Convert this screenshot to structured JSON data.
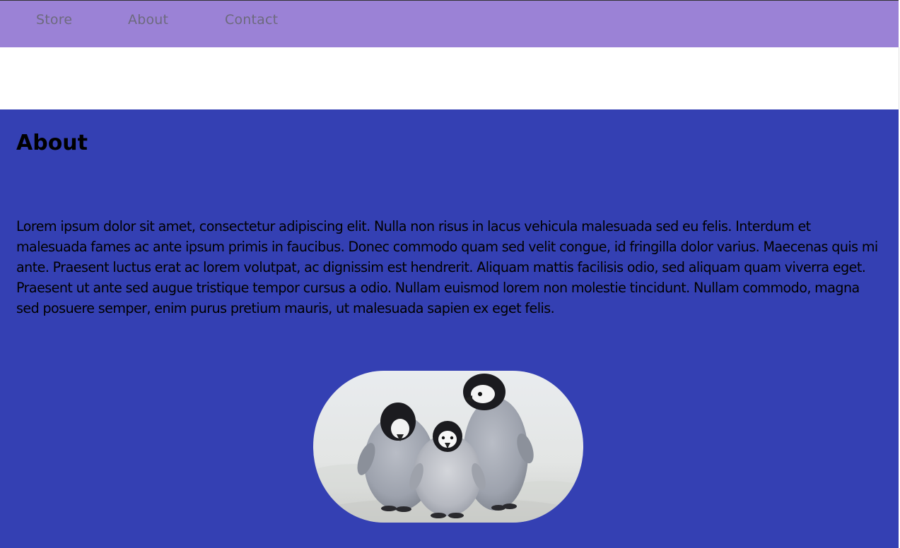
{
  "nav": {
    "links": [
      {
        "label": "Store"
      },
      {
        "label": "About"
      },
      {
        "label": "Contact"
      }
    ]
  },
  "colors": {
    "navbar": "#9b82d6",
    "section": "#3440b3"
  },
  "about": {
    "heading": "About",
    "text": "Lorem ipsum dolor sit amet, consectetur adipiscing elit. Nulla non risus in lacus vehicula malesuada sed eu felis. Interdum et malesuada fames ac ante ipsum primis in faucibus. Donec commodo quam sed velit congue, id fringilla dolor varius. Maecenas quis mi ante. Praesent luctus erat ac lorem volutpat, ac dignissim est hendrerit. Aliquam mattis facilisis odio, sed aliquam quam viverra eget. Praesent ut ante sed augue tristique tempor cursus a odio. Nullam euismod lorem non molestie tincidunt. Nullam commodo, magna sed posuere semper, enim purus pretium mauris, ut malesuada sapien ex eget felis.",
    "image_subject": "three penguin chicks on snow"
  }
}
